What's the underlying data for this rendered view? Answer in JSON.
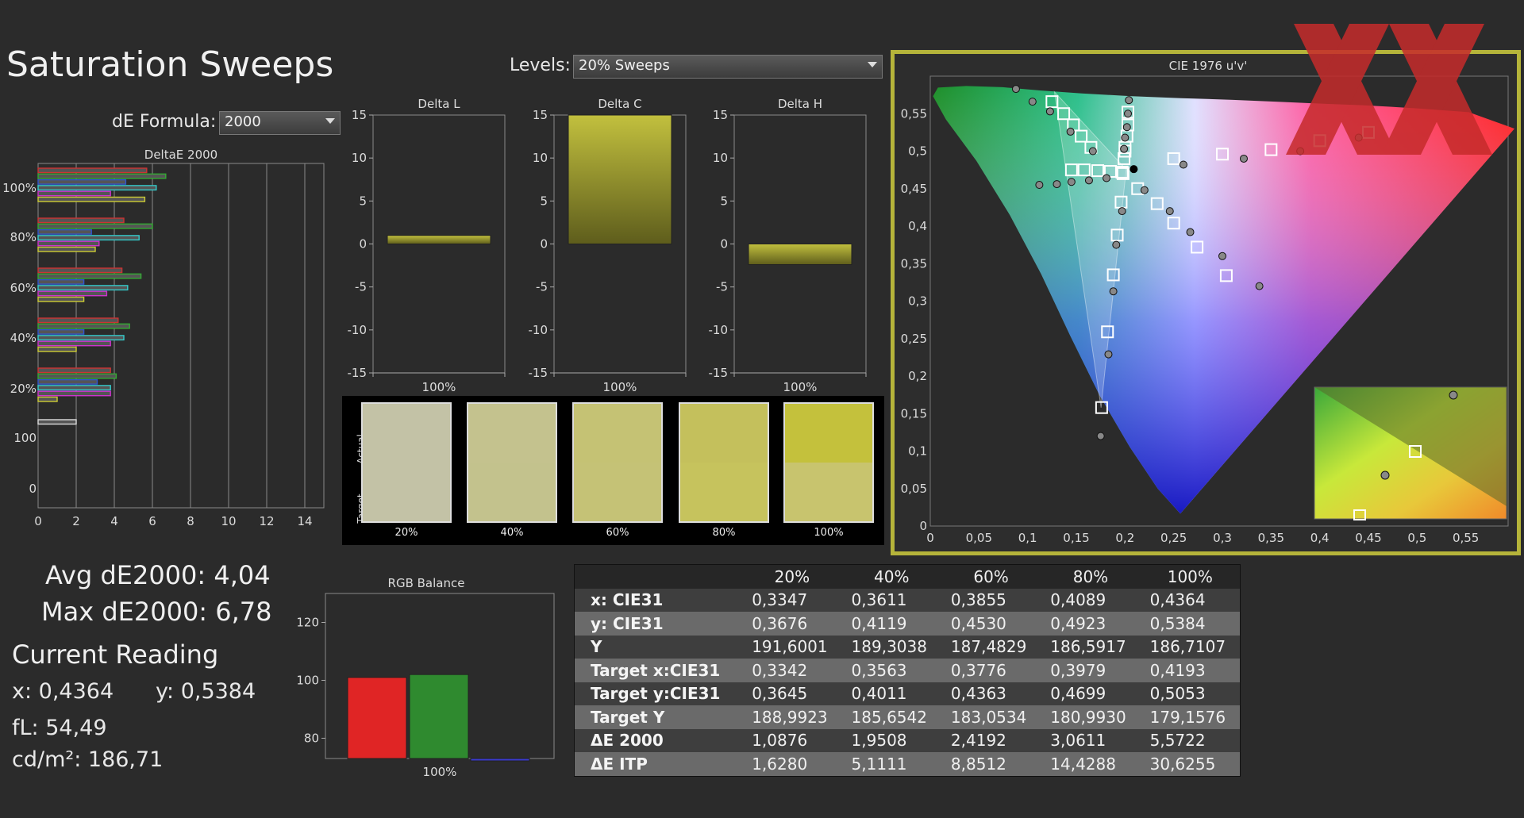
{
  "header": {
    "title": "Saturation Sweeps",
    "levels_label": "Levels:",
    "levels_value": "20% Sweeps",
    "de_formula_label": "dE Formula:",
    "de_formula_value": "2000"
  },
  "colors": {
    "background": "#2b2b2b",
    "accent_yellow": "#b9b83c",
    "cie_frame": "#b5b43a",
    "red_bar": "#e02525",
    "green_bar": "#2f8a2f",
    "blue_bar": "#3a3acc"
  },
  "stats": {
    "avg": "Avg dE2000: 4,04",
    "max": "Max dE2000: 6,78",
    "current_reading": "Current Reading",
    "x": "x: 0,4364",
    "y": "y: 0,5384",
    "fl": "fL: 54,49",
    "cdm2": "cd/m²: 186,71"
  },
  "chart_data": [
    {
      "type": "bar",
      "title": "DeltaE 2000",
      "orientation": "horizontal",
      "groups": [
        "100%",
        "80%",
        "60%",
        "40%",
        "20%",
        "100"
      ],
      "series_colors": [
        "#cc3333",
        "#33aa33",
        "#3355cc",
        "#33cccc",
        "#cc33cc",
        "#cccc33"
      ],
      "values": [
        [
          5.7,
          6.7,
          4.6,
          6.2,
          3.8,
          5.6
        ],
        [
          4.5,
          6.0,
          2.8,
          5.3,
          3.2,
          3.0
        ],
        [
          4.4,
          5.4,
          2.4,
          4.7,
          3.6,
          2.4
        ],
        [
          4.2,
          4.8,
          2.4,
          4.5,
          3.8,
          2.0
        ],
        [
          3.8,
          4.1,
          3.1,
          3.8,
          3.8,
          1.0
        ],
        [
          2.0
        ]
      ],
      "xlim": [
        0,
        15
      ],
      "xticks": [
        "0",
        "2",
        "4",
        "6",
        "8",
        "10",
        "12",
        "14"
      ],
      "ytick_labels": [
        "100%",
        "80%",
        "60%",
        "40%",
        "20%",
        "100",
        "0"
      ]
    },
    {
      "type": "bar",
      "title": "Delta L",
      "categories": [
        "100%"
      ],
      "values": [
        1.0
      ],
      "ylim": [
        -15,
        15
      ],
      "yticks": [
        "15",
        "10",
        "5",
        "0",
        "-5",
        "-10",
        "-15"
      ]
    },
    {
      "type": "bar",
      "title": "Delta C",
      "categories": [
        "100%"
      ],
      "values": [
        15.0
      ],
      "ylim": [
        -15,
        15
      ],
      "yticks": [
        "15",
        "10",
        "5",
        "0",
        "-5",
        "-10",
        "-15"
      ]
    },
    {
      "type": "bar",
      "title": "Delta H",
      "categories": [
        "100%"
      ],
      "values": [
        -2.4
      ],
      "ylim": [
        -15,
        15
      ],
      "yticks": [
        "15",
        "10",
        "5",
        "0",
        "-5",
        "-10",
        "-15"
      ]
    },
    {
      "type": "bar",
      "title": "RGB Balance",
      "categories": [
        "100%"
      ],
      "series": [
        {
          "color": "#e02525",
          "values": [
            101
          ]
        },
        {
          "color": "#2f8a2f",
          "values": [
            102
          ]
        },
        {
          "color": "#3a3acc",
          "values": [
            73
          ]
        }
      ],
      "ylim": [
        73,
        130
      ],
      "yticks": [
        "120",
        "100",
        "80"
      ]
    },
    {
      "type": "scatter",
      "title": "CIE 1976 u'v'",
      "xlim": [
        0,
        0.6
      ],
      "ylim": [
        0,
        0.6
      ],
      "xticks": [
        "0",
        "0,05",
        "0,1",
        "0,15",
        "0,2",
        "0,25",
        "0,3",
        "0,35",
        "0,4",
        "0,45",
        "0,5",
        "0,55"
      ],
      "yticks": [
        "0",
        "0,05",
        "0,1",
        "0,15",
        "0,2",
        "0,25",
        "0,3",
        "0,35",
        "0,4",
        "0,45",
        "0,5",
        "0,55"
      ],
      "gamut_triangle": [
        [
          0.1275,
          0.5792
        ],
        [
          0.2012,
          0.4755
        ],
        [
          0.1754,
          0.1579
        ],
        [
          0.4507,
          0.5229
        ]
      ],
      "targets": [
        [
          0.125,
          0.566
        ],
        [
          0.137,
          0.55
        ],
        [
          0.147,
          0.535
        ],
        [
          0.155,
          0.52
        ],
        [
          0.165,
          0.505
        ],
        [
          0.145,
          0.475
        ],
        [
          0.158,
          0.475
        ],
        [
          0.172,
          0.474
        ],
        [
          0.185,
          0.473
        ],
        [
          0.197,
          0.472
        ],
        [
          0.203,
          0.552
        ],
        [
          0.203,
          0.535
        ],
        [
          0.202,
          0.52
        ],
        [
          0.2,
          0.505
        ],
        [
          0.199,
          0.49
        ],
        [
          0.2,
          0.5
        ],
        [
          0.25,
          0.49
        ],
        [
          0.3,
          0.496
        ],
        [
          0.35,
          0.502
        ],
        [
          0.4,
          0.514
        ],
        [
          0.45,
          0.525
        ],
        [
          0.196,
          0.432
        ],
        [
          0.192,
          0.388
        ],
        [
          0.188,
          0.335
        ],
        [
          0.182,
          0.259
        ],
        [
          0.176,
          0.158
        ],
        [
          0.213,
          0.45
        ],
        [
          0.233,
          0.43
        ],
        [
          0.25,
          0.404
        ],
        [
          0.274,
          0.372
        ],
        [
          0.304,
          0.334
        ],
        [
          0.198,
          0.47
        ],
        [
          0.197,
          0.472
        ]
      ],
      "measured": [
        [
          0.088,
          0.583
        ],
        [
          0.105,
          0.566
        ],
        [
          0.123,
          0.553
        ],
        [
          0.144,
          0.526
        ],
        [
          0.167,
          0.5
        ],
        [
          0.112,
          0.455
        ],
        [
          0.13,
          0.456
        ],
        [
          0.145,
          0.459
        ],
        [
          0.163,
          0.461
        ],
        [
          0.181,
          0.464
        ],
        [
          0.204,
          0.568
        ],
        [
          0.203,
          0.55
        ],
        [
          0.202,
          0.532
        ],
        [
          0.2,
          0.518
        ],
        [
          0.199,
          0.503
        ],
        [
          0.26,
          0.482
        ],
        [
          0.322,
          0.49
        ],
        [
          0.38,
          0.5
        ],
        [
          0.44,
          0.518
        ],
        [
          0.197,
          0.42
        ],
        [
          0.191,
          0.375
        ],
        [
          0.188,
          0.313
        ],
        [
          0.183,
          0.229
        ],
        [
          0.175,
          0.12
        ],
        [
          0.22,
          0.448
        ],
        [
          0.246,
          0.42
        ],
        [
          0.267,
          0.392
        ],
        [
          0.3,
          0.36
        ],
        [
          0.338,
          0.32
        ]
      ],
      "current_measured": [
        0.209,
        0.476
      ]
    }
  ],
  "swatches": {
    "actual_label": "Actual",
    "target_label": "Target",
    "items": [
      {
        "label": "20%",
        "actual": "#c3c2a6",
        "target": "#c3c2a6"
      },
      {
        "label": "40%",
        "actual": "#c4c28e",
        "target": "#c3c28d"
      },
      {
        "label": "60%",
        "actual": "#c5c274",
        "target": "#c5c276"
      },
      {
        "label": "80%",
        "actual": "#c4c05c",
        "target": "#c6c35d"
      },
      {
        "label": "100%",
        "actual": "#c4c13c",
        "target": "#c8c46e"
      }
    ]
  },
  "table": {
    "columns": [
      "",
      "20%",
      "40%",
      "60%",
      "80%",
      "100%"
    ],
    "rows": [
      {
        "label": "x: CIE31",
        "values": [
          "0,3347",
          "0,3611",
          "0,3855",
          "0,4089",
          "0,4364"
        ]
      },
      {
        "label": "y: CIE31",
        "values": [
          "0,3676",
          "0,4119",
          "0,4530",
          "0,4923",
          "0,5384"
        ]
      },
      {
        "label": "Y",
        "values": [
          "191,6001",
          "189,3038",
          "187,4829",
          "186,5917",
          "186,7107"
        ]
      },
      {
        "label": "Target x:CIE31",
        "values": [
          "0,3342",
          "0,3563",
          "0,3776",
          "0,3979",
          "0,4193"
        ]
      },
      {
        "label": "Target y:CIE31",
        "values": [
          "0,3645",
          "0,4011",
          "0,4363",
          "0,4699",
          "0,5053"
        ]
      },
      {
        "label": "Target Y",
        "values": [
          "188,9923",
          "185,6542",
          "183,0534",
          "180,9930",
          "179,1576"
        ]
      },
      {
        "label": "ΔE 2000",
        "values": [
          "1,0876",
          "1,9508",
          "2,4192",
          "3,0611",
          "5,5722"
        ]
      },
      {
        "label": "ΔE ITP",
        "values": [
          "1,6280",
          "5,1111",
          "8,8512",
          "14,4288",
          "30,6255"
        ]
      }
    ]
  }
}
